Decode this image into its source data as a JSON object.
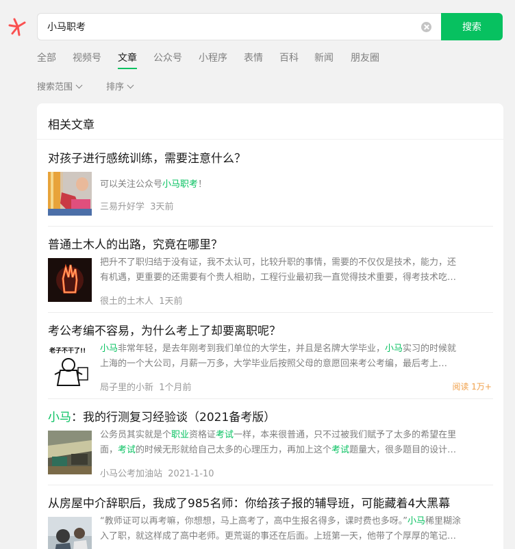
{
  "search": {
    "query": "小马职考",
    "button_label": "搜索"
  },
  "tabs": [
    "全部",
    "视频号",
    "文章",
    "公众号",
    "小程序",
    "表情",
    "百科",
    "新闻",
    "朋友圈"
  ],
  "active_tab": "文章",
  "filters": {
    "scope_label": "搜索范围",
    "sort_label": "排序"
  },
  "section_title": "相关文章",
  "articles": [
    {
      "title": "对孩子进行感统训练，需要注意什么？",
      "desc_a": "可以关注公众号",
      "desc_hl": "小马职考",
      "desc_b": "！",
      "source": "三易升好学",
      "time": "3天前"
    },
    {
      "title": "普通土木人的出路，究竟在哪里？",
      "desc_line1": "把升不了职归结于没有证，我不太认可，比较升职的事情，需要的不仅仅是技术，能力，还",
      "desc_line2": "有机遇，更重要的还需要有个贵人相助，工程行业最初我一直觉得技术重要，得考技术吃…",
      "source": "很土的土木人",
      "time": "1天前"
    },
    {
      "title": "考公考编不容易，为什么考上了却要离职呢？",
      "l1_hl": "小马",
      "l1_a": "非常年轻，是去年刚考到我们单位的大学生，并且是名牌大学毕业，",
      "l1_hl2": "小马",
      "l1_b": "实习的时候就",
      "desc_line2": "上海的一个大公司，月薪一万多，大学毕业后按照父母的意愿回来考公考编，最后考上…",
      "source": "局子里的小新",
      "time": "1个月前",
      "reads": "阅读 1万+",
      "thumb_text": "老子不干了!!"
    },
    {
      "title_hl": "小马",
      "title_rest": "：我的行测复习经验谈（2021备考版）",
      "l1_a": "公务员其实就是个",
      "l1_hl": "职业",
      "l1_b": "资格证",
      "l1_hl2": "考试",
      "l1_c": "一样，本来很普通，只不过被我们赋予了太多的希望在里",
      "l2_a": "面，",
      "l2_hl": "考试",
      "l2_b": "的时候无形就给自己太多的心理压力，再加上这个",
      "l2_hl2": "考试",
      "l2_c": "题量大，很多题目的设计…",
      "source": "小马公考加油站",
      "time": "2021-1-10"
    },
    {
      "title": "从房屋中介辞职后，我成了985名师：你给孩子报的辅导班，可能藏着4大黑幕",
      "l1_a": "“教师证可以再考嘛，你想想，马上高考了，高中生报名得多，课时费也多呀。”",
      "l1_hl": "小马",
      "l1_b": "稀里糊涂",
      "desc_line2": "入了职，就这样成了高中老师。更荒诞的事还在后面。上班第一天，他带了个厚厚的笔记…"
    }
  ]
}
